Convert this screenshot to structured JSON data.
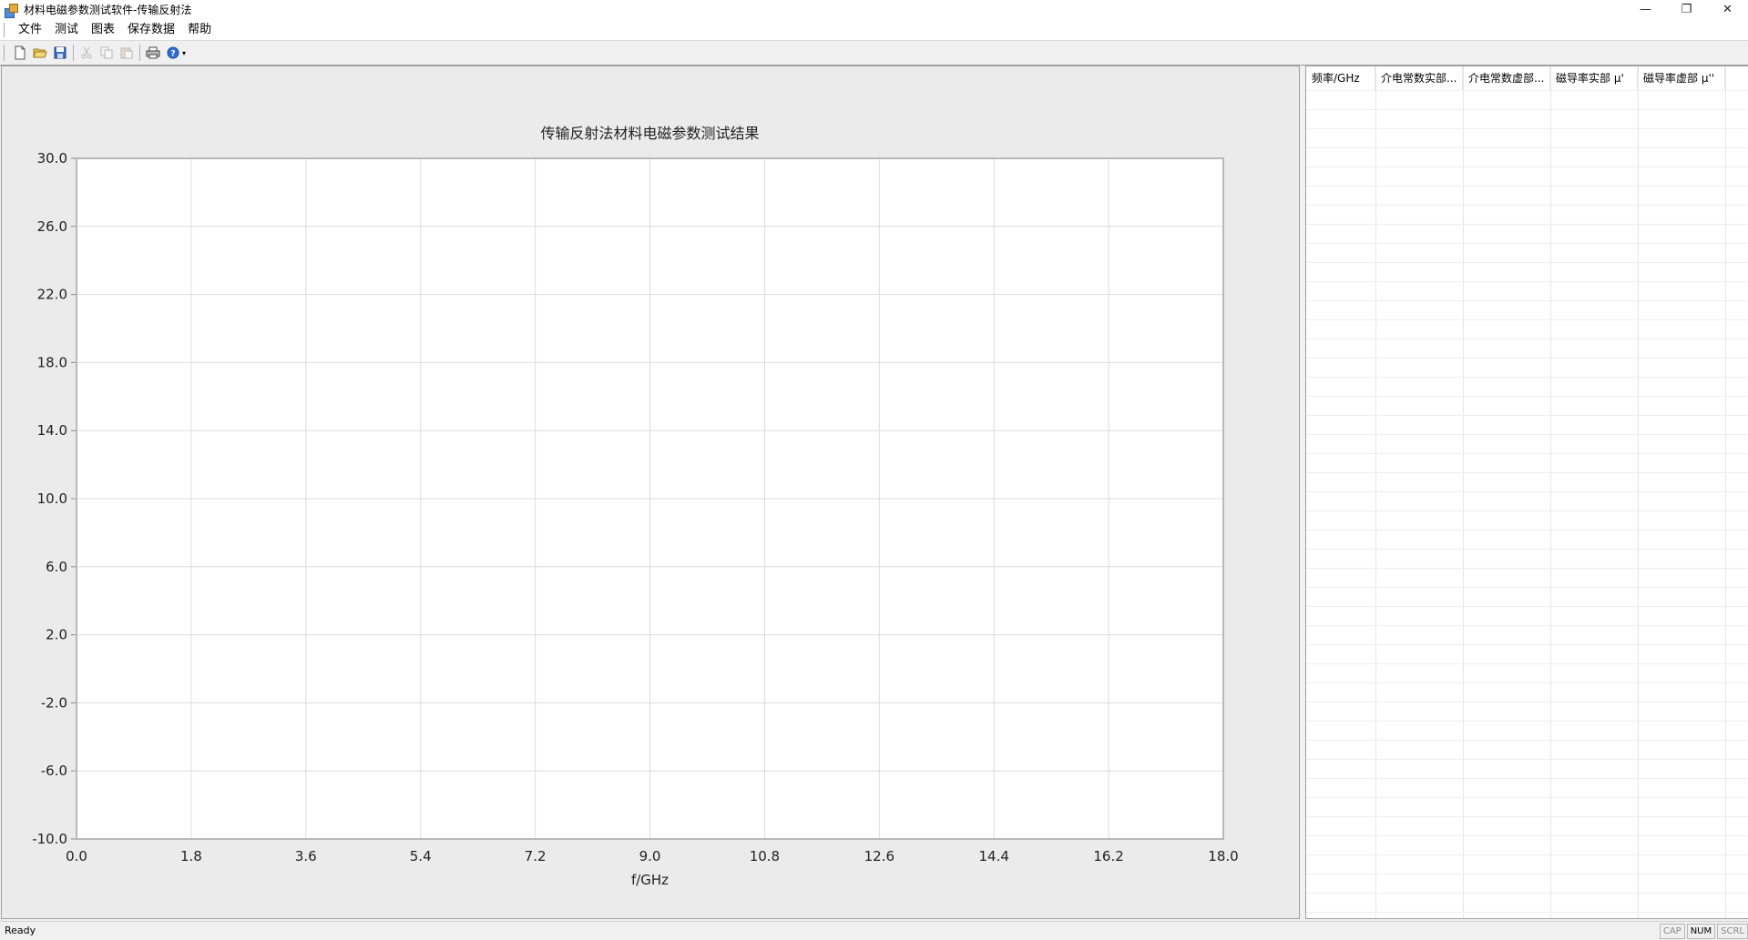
{
  "window": {
    "title": "材料电磁参数测试软件-传输反射法",
    "controls": [
      "—",
      "❐",
      "✕"
    ]
  },
  "menu": [
    "文件",
    "测试",
    "图表",
    "保存数据",
    "帮助"
  ],
  "toolbar": {
    "buttons": [
      "new-file-icon",
      "open-folder-icon",
      "save-icon",
      "cut-icon",
      "copy-icon",
      "paste-icon",
      "print-icon",
      "help-icon"
    ],
    "disabled": [
      "cut-icon",
      "copy-icon",
      "paste-icon"
    ]
  },
  "chart_data": {
    "type": "line",
    "title": "传输反射法材料电磁参数测试结果",
    "xlabel": "f/GHz",
    "ylabel": "",
    "xlim": [
      0.0,
      18.0
    ],
    "ylim": [
      -10.0,
      30.0
    ],
    "x_ticks": [
      "0.0",
      "1.8",
      "3.6",
      "5.4",
      "7.2",
      "9.0",
      "10.8",
      "12.6",
      "14.4",
      "16.2",
      "18.0"
    ],
    "y_ticks": [
      "30.0",
      "26.0",
      "22.0",
      "18.0",
      "14.0",
      "10.0",
      "6.0",
      "2.0",
      "-2.0",
      "-6.0",
      "-10.0"
    ],
    "grid": true,
    "series": []
  },
  "table": {
    "columns": [
      "频率/GHz",
      "介电常数实部...",
      "介电常数虚部...",
      "磁导率实部 μ'",
      "磁导率虚部 μ''"
    ],
    "rows": []
  },
  "status": {
    "text": "Ready",
    "indicators": [
      "CAP",
      "NUM",
      "SCRL"
    ],
    "active": [
      "NUM"
    ]
  }
}
